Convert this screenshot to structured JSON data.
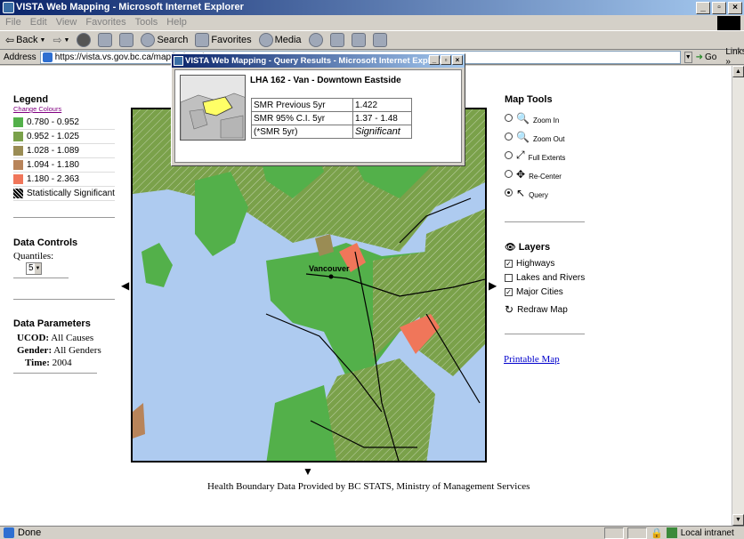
{
  "window": {
    "title": "VISTA Web Mapping - Microsoft Internet Explorer"
  },
  "menu": [
    "File",
    "Edit",
    "View",
    "Favorites",
    "Tools",
    "Help"
  ],
  "toolbar": {
    "back": "Back",
    "search": "Search",
    "favorites": "Favorites",
    "media": "Media"
  },
  "address": {
    "label": "Address",
    "url": "https://vista.vs.gov.bc.ca/map/index.pl",
    "go": "Go",
    "links": "Links »"
  },
  "legend": {
    "title": "Legend",
    "change_colours": "Change Colours",
    "items": [
      {
        "label": "0.780 - 0.952",
        "color": "#53b04a"
      },
      {
        "label": "0.952 - 1.025",
        "color": "#7aa14a"
      },
      {
        "label": "1.028 - 1.089",
        "color": "#9a8c54"
      },
      {
        "label": "1.094 - 1.180",
        "color": "#b8845a"
      },
      {
        "label": "1.180 - 2.363",
        "color": "#f0765a"
      }
    ],
    "significant": "Statistically Significant"
  },
  "data_controls": {
    "title": "Data Controls",
    "quantiles_label": "Quantiles:",
    "quantiles_value": "5"
  },
  "data_parameters": {
    "title": "Data Parameters",
    "ucod_label": "UCOD:",
    "ucod_value": "All Causes",
    "gender_label": "Gender:",
    "gender_value": "All Genders",
    "time_label": "Time:",
    "time_value": "2004"
  },
  "map": {
    "city_label": "Vancouver"
  },
  "map_tools": {
    "title": "Map Tools",
    "tools": [
      {
        "label": "Zoom In",
        "selected": false
      },
      {
        "label": "Zoom Out",
        "selected": false
      },
      {
        "label": "Full Extents",
        "selected": false
      },
      {
        "label": "Re-Center",
        "selected": false
      },
      {
        "label": "Query",
        "selected": true
      }
    ]
  },
  "layers": {
    "title": "Layers",
    "items": [
      {
        "label": "Highways",
        "checked": true
      },
      {
        "label": "Lakes and Rivers",
        "checked": false
      },
      {
        "label": "Major Cities",
        "checked": true
      }
    ],
    "redraw": "Redraw Map"
  },
  "printable_map": "Printable Map",
  "footer": "Health Boundary Data Provided by BC STATS, Ministry of Management Services",
  "popup": {
    "title": "VISTA Web Mapping - Query Results - Microsoft Internet Explorer",
    "region": "LHA 162 - Van - Downtown Eastside",
    "rows": [
      {
        "label": "SMR Previous 5yr",
        "value": "1.422"
      },
      {
        "label": "SMR 95% C.I. 5yr",
        "value": "1.37 - 1.48"
      },
      {
        "label": "(*SMR 5yr)",
        "value": "Significant"
      }
    ]
  },
  "status": {
    "left": "Done",
    "right": "Local intranet"
  }
}
